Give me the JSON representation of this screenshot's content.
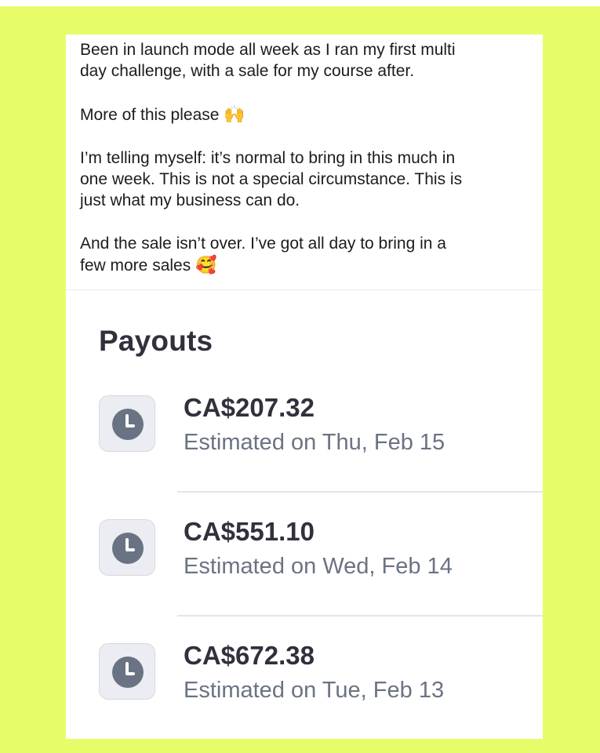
{
  "post": {
    "paragraph1": "Been in launch mode all week as I ran my first multi\nday challenge, with a sale for my course after.",
    "paragraph2": "More of this please",
    "paragraph2_emoji": "🙌",
    "paragraph3": "I’m telling myself: it’s normal to bring in this much in\none week. This is not a special circumstance. This is\njust what my business can do.",
    "paragraph4": "And the sale isn’t over. I’ve got all day to bring in a\nfew more sales",
    "paragraph4_emoji": "🥰"
  },
  "payouts": {
    "title": "Payouts",
    "items": [
      {
        "amount": "CA$207.32",
        "estimate": "Estimated on Thu, Feb 15",
        "icon": "clock-icon"
      },
      {
        "amount": "CA$551.10",
        "estimate": "Estimated on Wed, Feb 14",
        "icon": "clock-icon"
      },
      {
        "amount": "CA$672.38",
        "estimate": "Estimated on Tue, Feb 13",
        "icon": "clock-icon"
      }
    ]
  },
  "colors": {
    "background": "#e8fc6a",
    "card": "#ffffff",
    "text_dark": "#30313d",
    "text_muted": "#6a7383",
    "icon": "#6a7383"
  }
}
